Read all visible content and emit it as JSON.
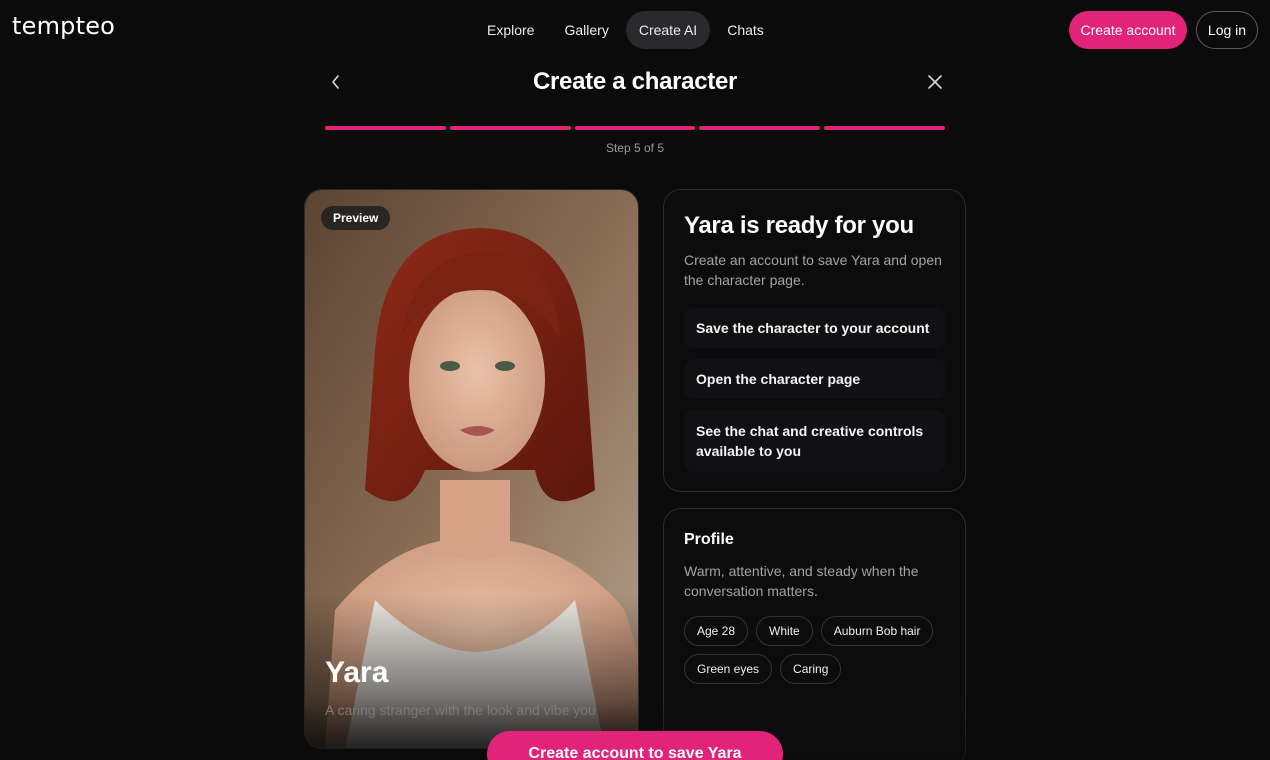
{
  "brand": {
    "logo": "tempteo",
    "accent": "#e2237a"
  },
  "nav": {
    "items": [
      {
        "label": "Explore"
      },
      {
        "label": "Gallery"
      },
      {
        "label": "Create AI"
      },
      {
        "label": "Chats"
      }
    ],
    "active": "Create AI"
  },
  "auth": {
    "create_account": "Create account",
    "login": "Log in"
  },
  "wizard": {
    "title": "Create a character",
    "step_label": "Step 5 of 5",
    "current_step": 5,
    "total_steps": 5,
    "back_icon": "chevron-left-icon",
    "close_icon": "close-icon"
  },
  "preview": {
    "badge": "Preview",
    "name": "Yara",
    "tagline": "A caring stranger with the look and vibe you"
  },
  "ready": {
    "title": "Yara is ready for you",
    "description": "Create an account to save Yara and open the character page.",
    "benefits": [
      "Save the character to your account",
      "Open the character page",
      "See the chat and creative controls available to you"
    ]
  },
  "profile": {
    "title": "Profile",
    "description": "Warm, attentive, and steady when the conversation matters.",
    "tags": [
      "Age 28",
      "White",
      "Auburn Bob hair",
      "Green eyes",
      "Caring"
    ]
  },
  "cta": {
    "label": "Create account to save Yara"
  }
}
